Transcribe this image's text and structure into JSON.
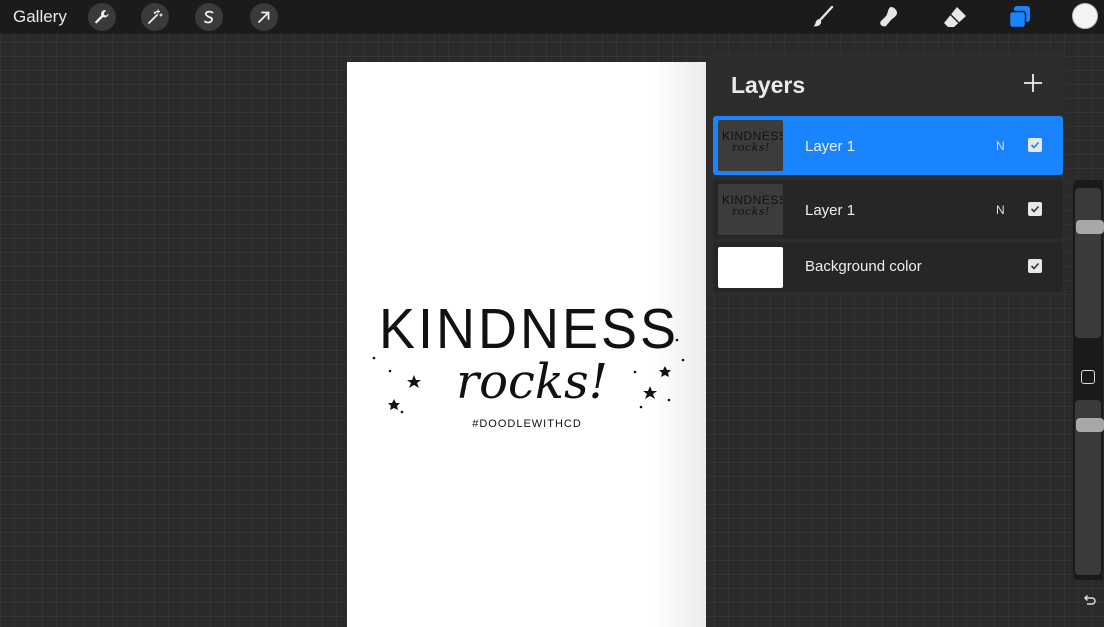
{
  "topbar": {
    "gallery_label": "Gallery",
    "left_tools": [
      {
        "name": "actions",
        "icon": "wrench-icon"
      },
      {
        "name": "adjustments",
        "icon": "magic-wand-icon"
      },
      {
        "name": "selection",
        "icon": "selection-s-icon"
      },
      {
        "name": "transform",
        "icon": "arrow-cursor-icon"
      }
    ],
    "right_tools": [
      {
        "name": "brush",
        "icon": "brush-icon"
      },
      {
        "name": "smudge",
        "icon": "smudge-icon"
      },
      {
        "name": "eraser",
        "icon": "eraser-icon"
      },
      {
        "name": "layers",
        "icon": "layers-icon",
        "active": true,
        "color": "#1a84ff"
      }
    ],
    "current_color": "#f3f3f3"
  },
  "canvas": {
    "line1": "KINDNESS",
    "line2": "rocks!",
    "line3": "#DOODLEWITHCD"
  },
  "layers_panel": {
    "title": "Layers",
    "add_icon": "plus-icon",
    "layers": [
      {
        "name": "Layer 1",
        "blend": "N",
        "visible": true,
        "selected": true,
        "thumb_line1": "KINDNESS",
        "thumb_line2": "rocks!"
      },
      {
        "name": "Layer 1",
        "blend": "N",
        "visible": true,
        "selected": false,
        "thumb_line1": "KINDNESS",
        "thumb_line2": "rocks!"
      },
      {
        "name": "Background color",
        "visible": true,
        "selected": false
      }
    ]
  },
  "sidebar": {
    "brush_size_level": 0.9,
    "opacity_level": 0.9
  },
  "colors": {
    "accent": "#1a84ff",
    "panel": "#2d2d2d",
    "topbar": "#1b1b1b"
  }
}
